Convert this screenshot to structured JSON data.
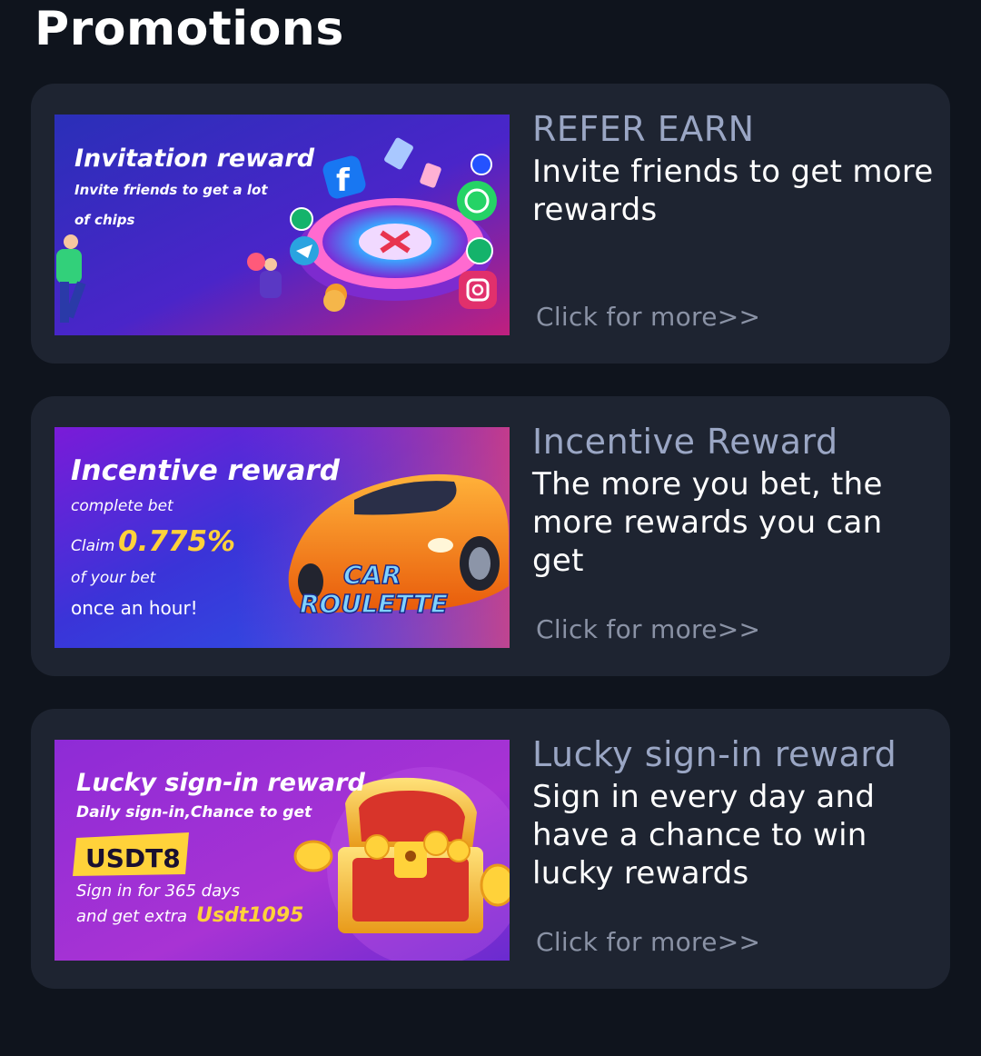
{
  "page": {
    "title": "Promotions"
  },
  "promotions": [
    {
      "title": "REFER EARN",
      "description": "Invite friends to get more rewards",
      "more": "Click for more>>",
      "banner": {
        "headline": "Invitation reward",
        "line1": "Invite friends to get a lot",
        "line2": "of chips",
        "icons": [
          "facebook-icon",
          "whatsapp-icon",
          "telegram-icon",
          "instagram-icon",
          "roulette-wheel-icon",
          "poker-chip-icon"
        ]
      }
    },
    {
      "title": "Incentive Reward",
      "description": "The more you bet, the more rewards you can get",
      "more": "Click for more>>",
      "banner": {
        "headline": "Incentive reward",
        "line1": "complete bet",
        "claim_label": "Claim",
        "claim_value": "0.775%",
        "line2": "of your bet",
        "line3": "once an hour!",
        "logo_line1": "CAR",
        "logo_line2": "ROULETTE",
        "icons": [
          "sports-car-icon"
        ]
      }
    },
    {
      "title": "Lucky sign-in reward",
      "description": "Sign in every day and have a chance to win lucky rewards",
      "more": "Click for more>>",
      "banner": {
        "headline": "Lucky sign-in reward",
        "line1": "Daily sign-in,Chance to get",
        "badge": "USDT8",
        "line2": "Sign in for 365 days",
        "line3_prefix": "and get extra",
        "line3_value": "Usdt1095",
        "icons": [
          "treasure-chest-icon",
          "gold-coin-icon"
        ]
      }
    }
  ],
  "colors": {
    "background": "#0f141d",
    "card": "#1e2431",
    "title_accent": "#9aa6c4",
    "link": "#8a92a5",
    "highlight_yellow": "#ffd23a"
  }
}
